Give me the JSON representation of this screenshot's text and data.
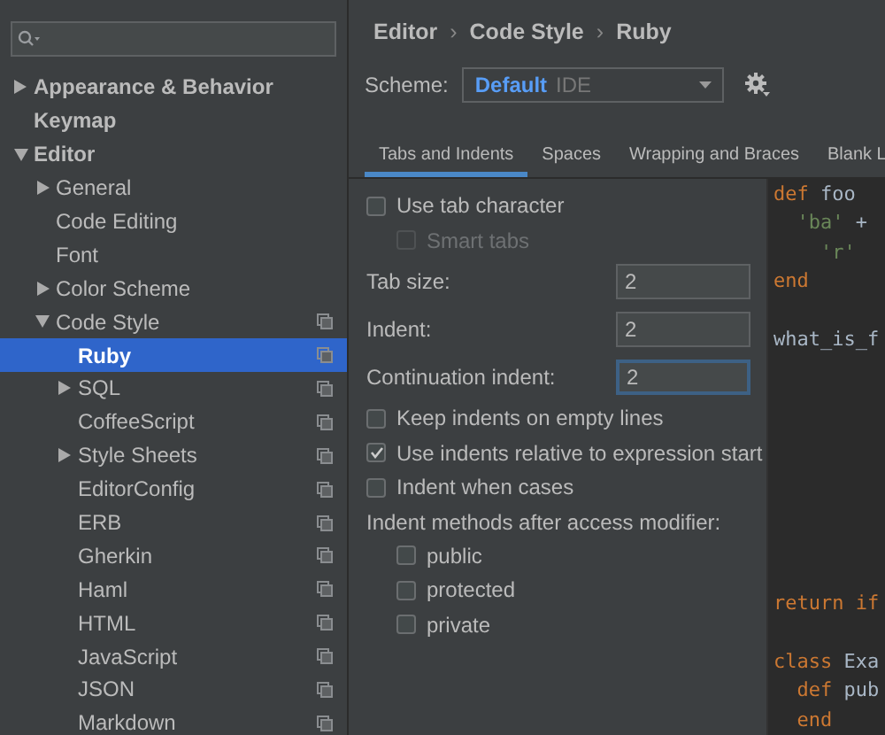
{
  "sidebar": {
    "tree": [
      {
        "label": "Appearance & Behavior",
        "expanded": false,
        "selected": false,
        "bold": true,
        "copy": false
      },
      {
        "label": "Keymap",
        "selected": false,
        "bold": true,
        "copy": false
      },
      {
        "label": "Editor",
        "expanded": true,
        "selected": false,
        "bold": true,
        "copy": false,
        "children": [
          {
            "label": "General",
            "expanded": false,
            "selected": false,
            "bold": false,
            "copy": false
          },
          {
            "label": "Code Editing",
            "selected": false,
            "bold": false,
            "copy": false
          },
          {
            "label": "Font",
            "selected": false,
            "bold": false,
            "copy": false
          },
          {
            "label": "Color Scheme",
            "expanded": false,
            "selected": false,
            "bold": false,
            "copy": false
          },
          {
            "label": "Code Style",
            "expanded": true,
            "selected": false,
            "bold": false,
            "copy": true,
            "children": [
              {
                "label": "Ruby",
                "selected": true,
                "bold": true,
                "copy": true
              },
              {
                "label": "SQL",
                "expanded": false,
                "selected": false,
                "bold": false,
                "copy": true
              },
              {
                "label": "CoffeeScript",
                "selected": false,
                "bold": false,
                "copy": true
              },
              {
                "label": "Style Sheets",
                "expanded": false,
                "selected": false,
                "bold": false,
                "copy": true
              },
              {
                "label": "EditorConfig",
                "selected": false,
                "bold": false,
                "copy": true
              },
              {
                "label": "ERB",
                "selected": false,
                "bold": false,
                "copy": true
              },
              {
                "label": "Gherkin",
                "selected": false,
                "bold": false,
                "copy": true
              },
              {
                "label": "Haml",
                "selected": false,
                "bold": false,
                "copy": true
              },
              {
                "label": "HTML",
                "selected": false,
                "bold": false,
                "copy": true
              },
              {
                "label": "JavaScript",
                "selected": false,
                "bold": false,
                "copy": true
              },
              {
                "label": "JSON",
                "selected": false,
                "bold": false,
                "copy": true
              },
              {
                "label": "Markdown",
                "selected": false,
                "bold": false,
                "copy": true
              }
            ]
          }
        ]
      }
    ]
  },
  "breadcrumbs": [
    "Editor",
    "›",
    "Code Style",
    "›",
    "Ruby"
  ],
  "scheme": {
    "label": "Scheme:",
    "name": "Default",
    "scope": "IDE"
  },
  "tabs": [
    {
      "label": "Tabs and Indents",
      "selected": true
    },
    {
      "label": "Spaces",
      "selected": false
    },
    {
      "label": "Wrapping and Braces",
      "selected": false
    },
    {
      "label": "Blank L",
      "selected": false
    }
  ],
  "options": [
    {
      "kind": "checkbox",
      "label": "Use tab character",
      "checked": false,
      "disabled": false,
      "children": [
        {
          "kind": "checkbox",
          "label": "Smart tabs",
          "checked": false,
          "disabled": true
        }
      ]
    },
    {
      "kind": "field",
      "label": "Tab size:",
      "value": "2",
      "focused": false
    },
    {
      "kind": "field",
      "label": "Indent:",
      "value": "2",
      "focused": false
    },
    {
      "kind": "field",
      "label": "Continuation indent:",
      "value": "2",
      "focused": true
    },
    {
      "kind": "checkbox",
      "label": "Keep indents on empty lines",
      "checked": false,
      "disabled": false
    },
    {
      "kind": "checkbox",
      "label": "Use indents relative to expression start",
      "checked": true,
      "disabled": false
    },
    {
      "kind": "checkbox",
      "label": "Indent when cases",
      "checked": false,
      "disabled": false
    },
    {
      "kind": "heading",
      "label": "Indent methods after access modifier:",
      "children": [
        {
          "kind": "checkbox",
          "label": "public",
          "checked": false,
          "disabled": false
        },
        {
          "kind": "checkbox",
          "label": "protected",
          "checked": false,
          "disabled": false
        },
        {
          "kind": "checkbox",
          "label": "private",
          "checked": false,
          "disabled": false
        }
      ]
    }
  ],
  "preview": {
    "blocks": [
      [
        [
          {
            "text": "def",
            "kind": "keyword"
          },
          {
            "text": " foo",
            "kind": "plain"
          }
        ],
        [
          {
            "text": "  'ba'",
            "kind": "string"
          },
          {
            "text": " +",
            "kind": "plain"
          }
        ],
        [
          {
            "text": "    'r'",
            "kind": "string"
          }
        ],
        [
          {
            "text": "end",
            "kind": "keyword"
          }
        ]
      ],
      [
        [
          {
            "text": "what_is_f",
            "kind": "plain"
          }
        ]
      ],
      [
        [
          {
            "text": "return",
            "kind": "keyword"
          },
          {
            "text": " if",
            "kind": "keyword"
          }
        ]
      ],
      [
        [
          {
            "text": "class",
            "kind": "keyword"
          },
          {
            "text": " Exa",
            "kind": "plain"
          }
        ],
        [
          {
            "text": "  def",
            "kind": "keyword"
          },
          {
            "text": " pub",
            "kind": "plain"
          }
        ],
        [
          {
            "text": "  end",
            "kind": "keyword"
          }
        ]
      ]
    ]
  }
}
